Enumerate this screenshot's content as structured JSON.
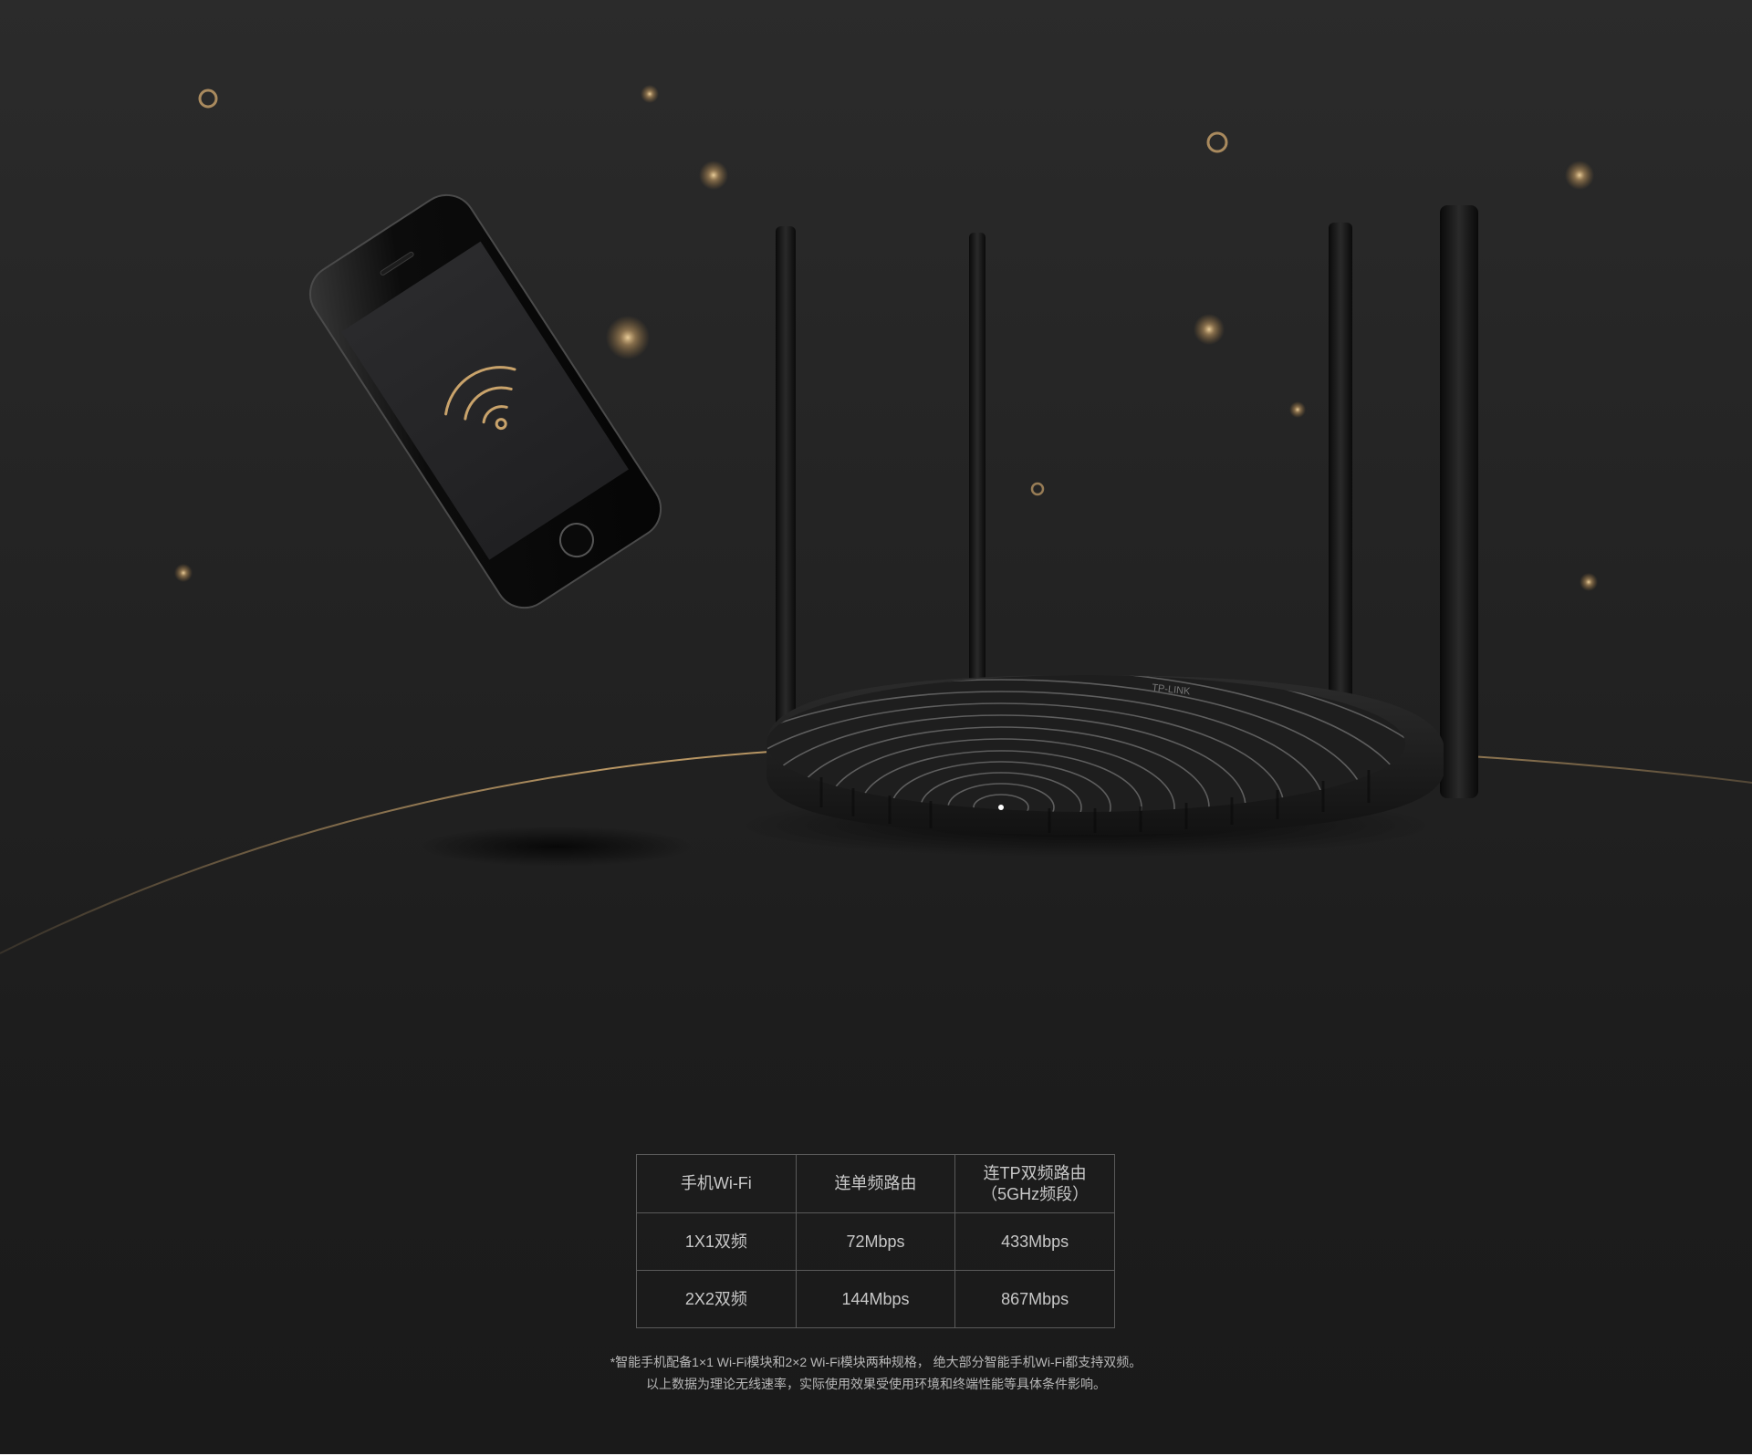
{
  "colors": {
    "gold": "#c9a36b",
    "line": "#5a5a5a",
    "text": "#c8c8c8"
  },
  "icons": {
    "phone": "smartphone-icon",
    "wifi": "wifi-icon",
    "router": "router-icon"
  },
  "router": {
    "brand": "TP-LINK"
  },
  "table": {
    "header": {
      "col1": "手机Wi-Fi",
      "col2": "连单频路由",
      "col3_line1": "连TP双频路由",
      "col3_line2": "（5GHz频段）"
    },
    "rows": [
      {
        "spec": "1X1双频",
        "single_band": "72Mbps",
        "dual_band": "433Mbps"
      },
      {
        "spec": "2X2双频",
        "single_band": "144Mbps",
        "dual_band": "867Mbps"
      }
    ]
  },
  "footnote": {
    "line1": "*智能手机配备1×1 Wi-Fi模块和2×2 Wi-Fi模块两种规格， 绝大部分智能手机Wi-Fi都支持双频。",
    "line2": "以上数据为理论无线速率，实际使用效果受使用环境和终端性能等具体条件影响。"
  }
}
